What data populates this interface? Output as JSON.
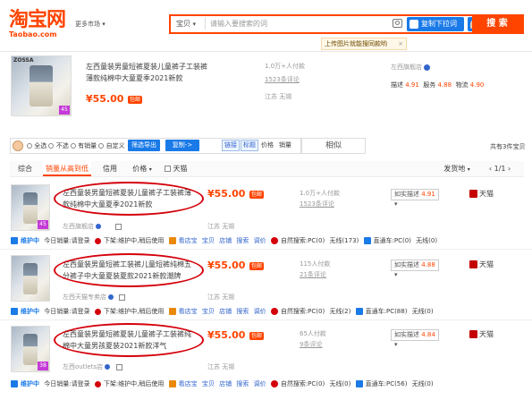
{
  "header": {
    "logo_cn": "淘宝网",
    "logo_en": "Taobao.com",
    "more_markets": "更多市场",
    "search_scope": "宝贝",
    "search_placeholder": "请输入要搜索的词",
    "copy_button": "复制下拉词",
    "search_button": "搜 索",
    "upload_tip": "上传图片就能搜同款哟",
    "close_tip": "×"
  },
  "featured": {
    "title": "左西童装男童短裤夏装儿童裤子工装裤薄款纯棉中大童夏季2021新款",
    "price": "¥55.00",
    "baoyou": "包邮",
    "sales": "1.0万+人付款",
    "reviews": "1523条评论",
    "location": "江苏 无锡",
    "shop_name": "左西旗舰店",
    "ratings": {
      "desc_label": "描述",
      "desc": "4.91",
      "service_label": "服务",
      "service": "4.88",
      "logistics_label": "物流",
      "logistics": "4.90"
    },
    "badge": "45",
    "brand": "ZOSSA"
  },
  "toolbar": {
    "items": [
      "全选",
      "不选",
      "有销量",
      "自定义"
    ],
    "filter_export": "筛选导出",
    "copy": "复制->",
    "link": "链接",
    "tag": "标题",
    "price": "价格",
    "sales": "销量",
    "similar": "相似",
    "total": "共有3件宝贝"
  },
  "tabs": {
    "items": [
      "综合",
      "销量从高到低",
      "信用",
      "价格",
      "天猫"
    ],
    "ship_from": "发货地",
    "page": "1/1"
  },
  "results": [
    {
      "title": "左西童装男童短裤夏装儿童裤子工装裤薄款纯棉中大童夏季2021新款",
      "price": "¥55.00",
      "baoyou": "包邮",
      "sales": "1.0万+人付款",
      "reviews": "1523条评论",
      "shop": "左西旗舰店",
      "location": "江苏 无锡",
      "rating_label": "如实描述",
      "rating": "4.91",
      "tmall": "天猫",
      "badge": "45",
      "info": [
        "维护中",
        "今日销量:请登录",
        "下架:维护中,稍后使用",
        "看店宝",
        "宝贝",
        "店铺",
        "搜索",
        "调价",
        "自然搜索:PC(0)",
        "无线(173)",
        "直通车:PC(0)",
        "无线(0)"
      ]
    },
    {
      "title": "左西童装男童短裤工装裤儿童短裤纯棉五分裤子中大童夏装夏款2021新款潮牌",
      "price": "¥55.00",
      "baoyou": "包邮",
      "sales": "115人付款",
      "reviews": "21条评论",
      "shop": "左西天猫专卖店",
      "location": "江苏 无锡",
      "rating_label": "如实描述",
      "rating": "4.88",
      "tmall": "天猫",
      "badge": "",
      "info": [
        "维护中",
        "今日销量:请登录",
        "下架:维护中,稍后使用",
        "看店宝",
        "宝贝",
        "店铺",
        "搜索",
        "调价",
        "自然搜索:PC(0)",
        "无线(2)",
        "直通车:PC(88)",
        "无线(0)"
      ]
    },
    {
      "title": "左西童装男童短裤夏装儿童裤子工装裤纯棉中大童男孩夏装2021新款洋气",
      "price": "¥55.00",
      "baoyou": "包邮",
      "sales": "65人付款",
      "reviews": "9条评论",
      "shop": "左西outlets店",
      "location": "江苏 无锡",
      "rating_label": "如实描述",
      "rating": "4.84",
      "tmall": "天猫",
      "badge": "38",
      "info": [
        "维护中",
        "今日销量:请登录",
        "下架:维护中,稍后使用",
        "看店宝",
        "宝贝",
        "店铺",
        "搜索",
        "调价",
        "自然搜索:PC(0)",
        "无线(0)",
        "直通车:PC(56)",
        "无线(0)"
      ]
    }
  ],
  "colors": {
    "accent": "#ff4400",
    "blue": "#1a7ae8",
    "annotation": "#d4000a"
  }
}
